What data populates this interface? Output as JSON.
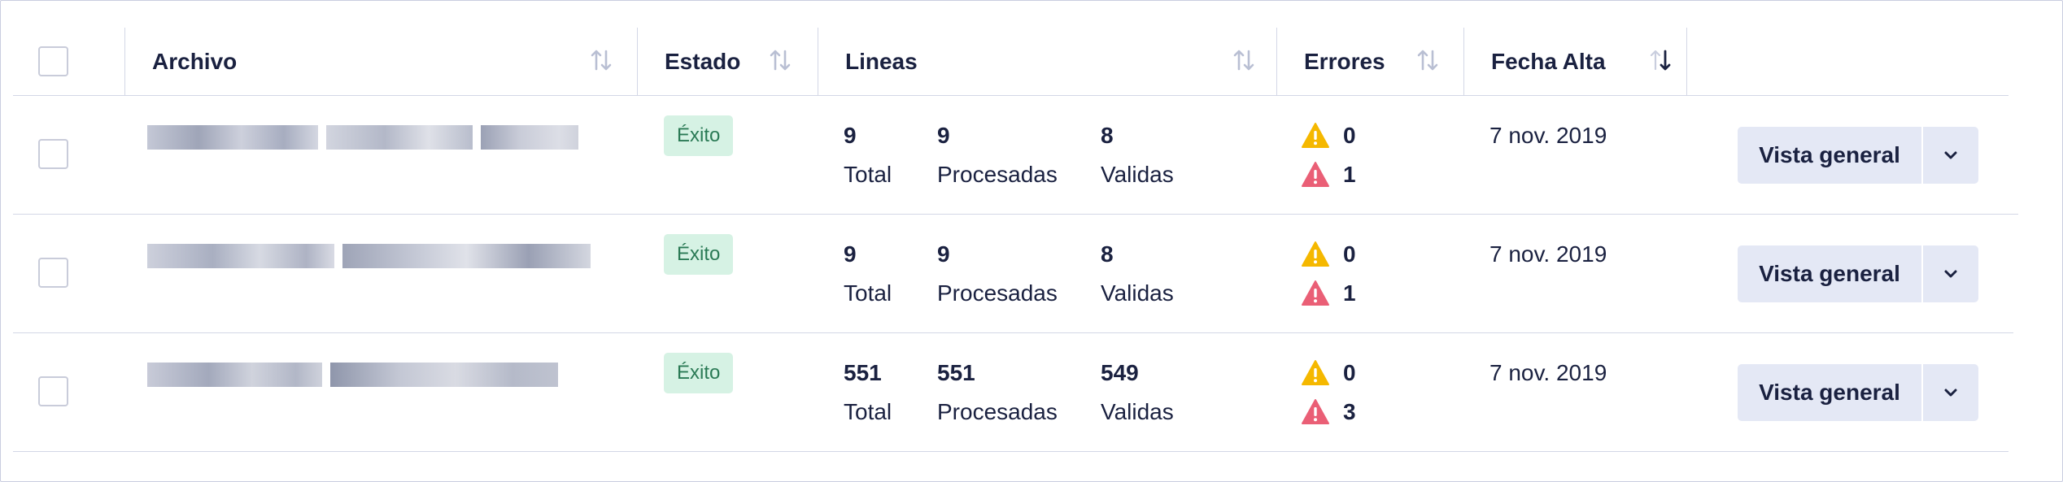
{
  "table": {
    "columns": [
      {
        "key": "archivo",
        "label": "Archivo"
      },
      {
        "key": "estado",
        "label": "Estado"
      },
      {
        "key": "lineas",
        "label": "Lineas"
      },
      {
        "key": "errores",
        "label": "Errores"
      },
      {
        "key": "fecha_alta",
        "label": "Fecha Alta",
        "sorted": "desc"
      }
    ],
    "rows": [
      {
        "filename_redacted": true,
        "estado": "Éxito",
        "total": "9",
        "total_label": "Total",
        "procesadas": "9",
        "procesadas_label": "Procesadas",
        "validas": "8",
        "validas_label": "Validas",
        "warnings": "0",
        "errors": "1",
        "fecha": "7 nov. 2019",
        "action_label": "Vista general"
      },
      {
        "filename_redacted": true,
        "estado": "Éxito",
        "total": "9",
        "total_label": "Total",
        "procesadas": "9",
        "procesadas_label": "Procesadas",
        "validas": "8",
        "validas_label": "Validas",
        "warnings": "0",
        "errors": "1",
        "fecha": "7 nov. 2019",
        "action_label": "Vista general"
      },
      {
        "filename_redacted": true,
        "estado": "Éxito",
        "total": "551",
        "total_label": "Total",
        "procesadas": "551",
        "procesadas_label": "Procesadas",
        "validas": "549",
        "validas_label": "Validas",
        "warnings": "0",
        "errors": "3",
        "fecha": "7 nov. 2019",
        "action_label": "Vista general"
      }
    ]
  },
  "icons": {
    "sort": "sort-arrows-icon",
    "sort_desc": "sort-desc-icon",
    "warning": "warning-triangle-icon",
    "error": "error-triangle-icon",
    "caret": "chevron-down-icon"
  },
  "colors": {
    "text": "#1a2140",
    "border": "#d3d7e6",
    "badge_bg": "#d6f2e4",
    "badge_text": "#2a7a55",
    "warning": "#f5b800",
    "error": "#ea5f76",
    "button_bg": "#e4e8f5",
    "sort_icon": "#b9bfd3"
  }
}
